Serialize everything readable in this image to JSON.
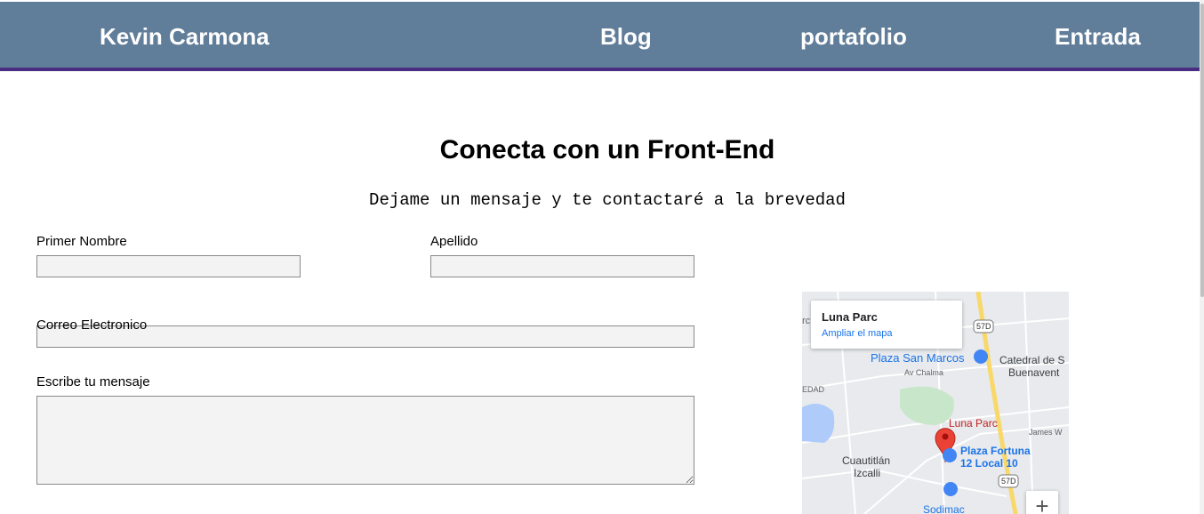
{
  "nav": {
    "brand": "Kevin Carmona",
    "links": [
      "Blog",
      "portafolio",
      "Entrada"
    ]
  },
  "heading": {
    "title": "Conecta con un Front-End",
    "subtitle": "Dejame un mensaje y te contactaré a la brevedad"
  },
  "form": {
    "first_name_label": "Primer Nombre",
    "first_name_value": "",
    "last_name_label": "Apellido",
    "last_name_value": "",
    "email_label": "Correo Electronico",
    "email_value": "",
    "message_label": "Escribe tu mensaje",
    "message_value": ""
  },
  "map": {
    "place_title": "Luna Parc",
    "expand_link": "Ampliar el mapa",
    "labels": {
      "plaza_san_marcos": "Plaza San Marcos",
      "catedral_1": "Catedral de S",
      "catedral_2": "Buenavent",
      "av_chalma": "Av Chalma",
      "luna_parc": "Luna Parc",
      "james": "James W",
      "plaza_fortuna_1": "Plaza Fortuna",
      "plaza_fortuna_2": "12 Local 10",
      "cuautitlan_1": "Cuautitlán",
      "cuautitlan_2": "Izcalli",
      "sodimac": "Sodimac",
      "road_57d_a": "57D",
      "road_57d_b": "57D",
      "edad": "EDAD",
      "rc": "rc"
    },
    "zoom_in": "+",
    "colors": {
      "land": "#e8eaed",
      "water": "#aecbfa",
      "park": "#c8e6c9",
      "highway": "#f9d86a",
      "pin": "#ea4335",
      "poi": "#4285f4"
    }
  },
  "colors": {
    "navbar": "#607d99",
    "navbar_border": "#4a2c80",
    "field_bg": "#f3f3f3"
  }
}
